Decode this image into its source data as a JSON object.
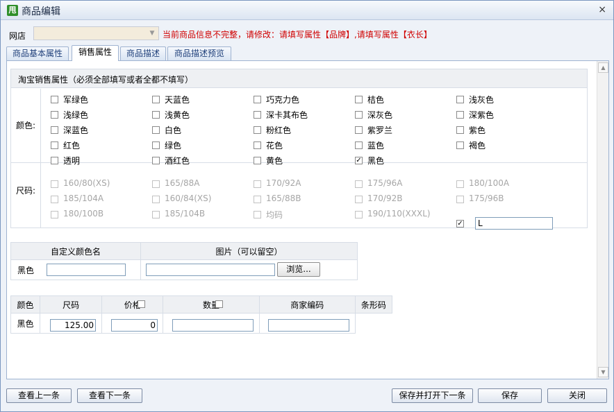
{
  "window": {
    "title": "商品编辑",
    "icon": "app-logo-icon",
    "close": "×"
  },
  "shop": {
    "label": "网店",
    "value": ""
  },
  "warning": "当前商品信息不完整，请修改：请填写属性【品牌】,请填写属性【衣长】",
  "tabs": [
    {
      "label": "商品基本属性",
      "active": false
    },
    {
      "label": "销售属性",
      "active": true
    },
    {
      "label": "商品描述",
      "active": false
    },
    {
      "label": "商品描述预览",
      "active": false
    }
  ],
  "sales_attrs": {
    "header": "淘宝销售属性（必须全部填写或者全都不填写）",
    "color_label": "颜色:",
    "colors": [
      {
        "name": "军绿色",
        "checked": false
      },
      {
        "name": "天蓝色",
        "checked": false
      },
      {
        "name": "巧克力色",
        "checked": false
      },
      {
        "name": "桔色",
        "checked": false
      },
      {
        "name": "浅灰色",
        "checked": false
      },
      {
        "name": "浅绿色",
        "checked": false
      },
      {
        "name": "浅黄色",
        "checked": false
      },
      {
        "name": "深卡其布色",
        "checked": false
      },
      {
        "name": "深灰色",
        "checked": false
      },
      {
        "name": "深紫色",
        "checked": false
      },
      {
        "name": "深蓝色",
        "checked": false
      },
      {
        "name": "白色",
        "checked": false
      },
      {
        "name": "粉红色",
        "checked": false
      },
      {
        "name": "紫罗兰",
        "checked": false
      },
      {
        "name": "紫色",
        "checked": false
      },
      {
        "name": "红色",
        "checked": false
      },
      {
        "name": "绿色",
        "checked": false
      },
      {
        "name": "花色",
        "checked": false
      },
      {
        "name": "蓝色",
        "checked": false
      },
      {
        "name": "褐色",
        "checked": false
      },
      {
        "name": "透明",
        "checked": false
      },
      {
        "name": "酒红色",
        "checked": false
      },
      {
        "name": "黄色",
        "checked": false
      },
      {
        "name": "黑色",
        "checked": true
      }
    ],
    "size_label": "尺码:",
    "sizes": [
      {
        "name": "160/80(XS)",
        "checked": false
      },
      {
        "name": "165/88A",
        "checked": false
      },
      {
        "name": "170/92A",
        "checked": false
      },
      {
        "name": "175/96A",
        "checked": false
      },
      {
        "name": "180/100A",
        "checked": false
      },
      {
        "name": "185/104A",
        "checked": false
      },
      {
        "name": "160/84(XS)",
        "checked": false
      },
      {
        "name": "165/88B",
        "checked": false
      },
      {
        "name": "170/92B",
        "checked": false
      },
      {
        "name": "175/96B",
        "checked": false
      },
      {
        "name": "180/100B",
        "checked": false
      },
      {
        "name": "185/104B",
        "checked": false
      },
      {
        "name": "均码",
        "checked": false
      },
      {
        "name": "190/110(XXXL)",
        "checked": false
      }
    ],
    "custom_size": {
      "checked": true,
      "value": "L"
    }
  },
  "custom_color": {
    "col_name": "自定义颜色名",
    "col_image": "图片（可以留空）",
    "row_label": "黑色",
    "name_value": "",
    "image_value": "",
    "browse_label": "浏览..."
  },
  "sku_table": {
    "headers": [
      "颜色",
      "尺码",
      "价格",
      "数量",
      "商家编码",
      "条形码"
    ],
    "row": {
      "color": "黑色",
      "price": "125.00",
      "quantity": "0",
      "merchant_code": "",
      "barcode": ""
    }
  },
  "footer": {
    "prev": "查看上一条",
    "next": "查看下一条",
    "save_open_next": "保存并打开下一条",
    "save": "保存",
    "close": "关闭"
  }
}
